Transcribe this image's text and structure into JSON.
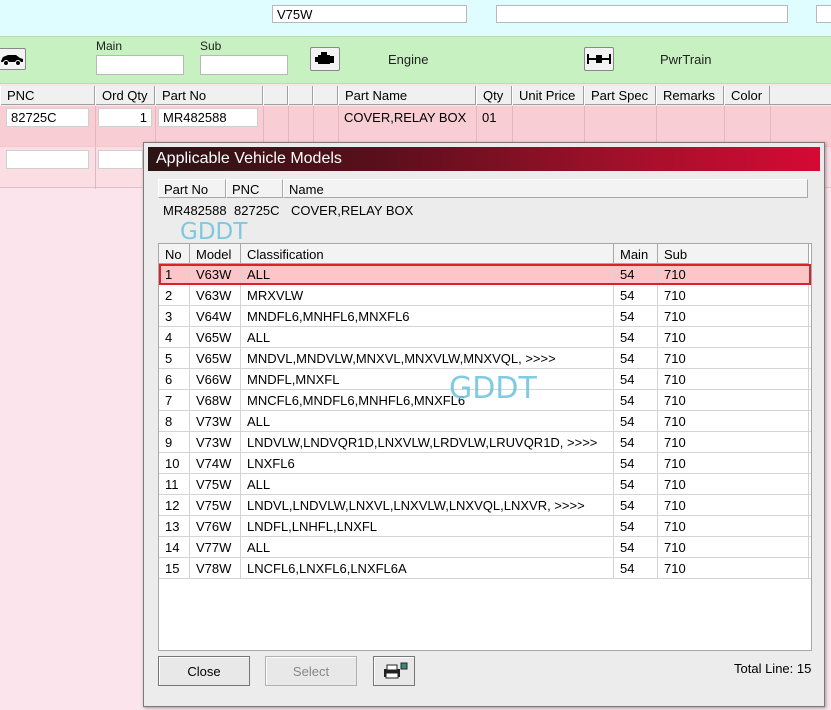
{
  "top": {
    "model_value": "V75W"
  },
  "toolbar": {
    "main_label": "Main",
    "main_value": "",
    "sub_label": "Sub",
    "sub_value": "",
    "engine_label": "Engine",
    "pwrtrain_label": "PwrTrain"
  },
  "parts_table": {
    "headers": [
      "PNC",
      "Ord Qty",
      "Part No",
      "",
      "",
      "Part Name",
      "Qty",
      "Unit Price",
      "Part Spec",
      "Remarks",
      "Color"
    ],
    "row": {
      "pnc": "82725C",
      "ord_qty": "1",
      "part_no": "MR482588",
      "part_name": "COVER,RELAY BOX",
      "qty": "01"
    }
  },
  "dialog": {
    "title": "Applicable Vehicle Models",
    "info_headers": [
      "Part No",
      "PNC",
      "Name"
    ],
    "info_values": {
      "part_no": "MR482588",
      "pnc": "82725C",
      "name": "COVER,RELAY BOX"
    },
    "grid_headers": [
      "No",
      "Model",
      "Classification",
      "Main",
      "Sub"
    ],
    "rows": [
      {
        "no": "1",
        "model": "V63W",
        "classification": "ALL",
        "main": "54",
        "sub": "710"
      },
      {
        "no": "2",
        "model": "V63W",
        "classification": "MRXVLW",
        "main": "54",
        "sub": "710"
      },
      {
        "no": "3",
        "model": "V64W",
        "classification": "MNDFL6,MNHFL6,MNXFL6",
        "main": "54",
        "sub": "710"
      },
      {
        "no": "4",
        "model": "V65W",
        "classification": "ALL",
        "main": "54",
        "sub": "710"
      },
      {
        "no": "5",
        "model": "V65W",
        "classification": "MNDVL,MNDVLW,MNXVL,MNXVLW,MNXVQL,  >>>>",
        "main": "54",
        "sub": "710"
      },
      {
        "no": "6",
        "model": "V66W",
        "classification": "MNDFL,MNXFL",
        "main": "54",
        "sub": "710"
      },
      {
        "no": "7",
        "model": "V68W",
        "classification": "MNCFL6,MNDFL6,MNHFL6,MNXFL6",
        "main": "54",
        "sub": "710"
      },
      {
        "no": "8",
        "model": "V73W",
        "classification": "ALL",
        "main": "54",
        "sub": "710"
      },
      {
        "no": "9",
        "model": "V73W",
        "classification": "LNDVLW,LNDVQR1D,LNXVLW,LRDVLW,LRUVQR1D,  >>>>",
        "main": "54",
        "sub": "710"
      },
      {
        "no": "10",
        "model": "V74W",
        "classification": "LNXFL6",
        "main": "54",
        "sub": "710"
      },
      {
        "no": "11",
        "model": "V75W",
        "classification": "ALL",
        "main": "54",
        "sub": "710"
      },
      {
        "no": "12",
        "model": "V75W",
        "classification": "LNDVL,LNDVLW,LNXVL,LNXVLW,LNXVQL,LNXVR,  >>>>",
        "main": "54",
        "sub": "710"
      },
      {
        "no": "13",
        "model": "V76W",
        "classification": "LNDFL,LNHFL,LNXFL",
        "main": "54",
        "sub": "710"
      },
      {
        "no": "14",
        "model": "V77W",
        "classification": "ALL",
        "main": "54",
        "sub": "710"
      },
      {
        "no": "15",
        "model": "V78W",
        "classification": "LNCFL6,LNXFL6,LNXFL6A",
        "main": "54",
        "sub": "710"
      }
    ],
    "close_label": "Close",
    "select_label": "Select",
    "total_line": "Total Line: 15"
  },
  "watermarks": [
    "GDDT",
    "GDDT"
  ],
  "icons": {
    "car": "car-icon",
    "engine": "engine-icon",
    "powertrain": "powertrain-icon",
    "printer": "printer-icon"
  },
  "colors": {
    "selected_row_bg": "#fcc6c9",
    "selected_row_border": "#d8232c",
    "toolbar_bg": "#c7f1c1",
    "title_gradient_end": "#d50a34"
  }
}
